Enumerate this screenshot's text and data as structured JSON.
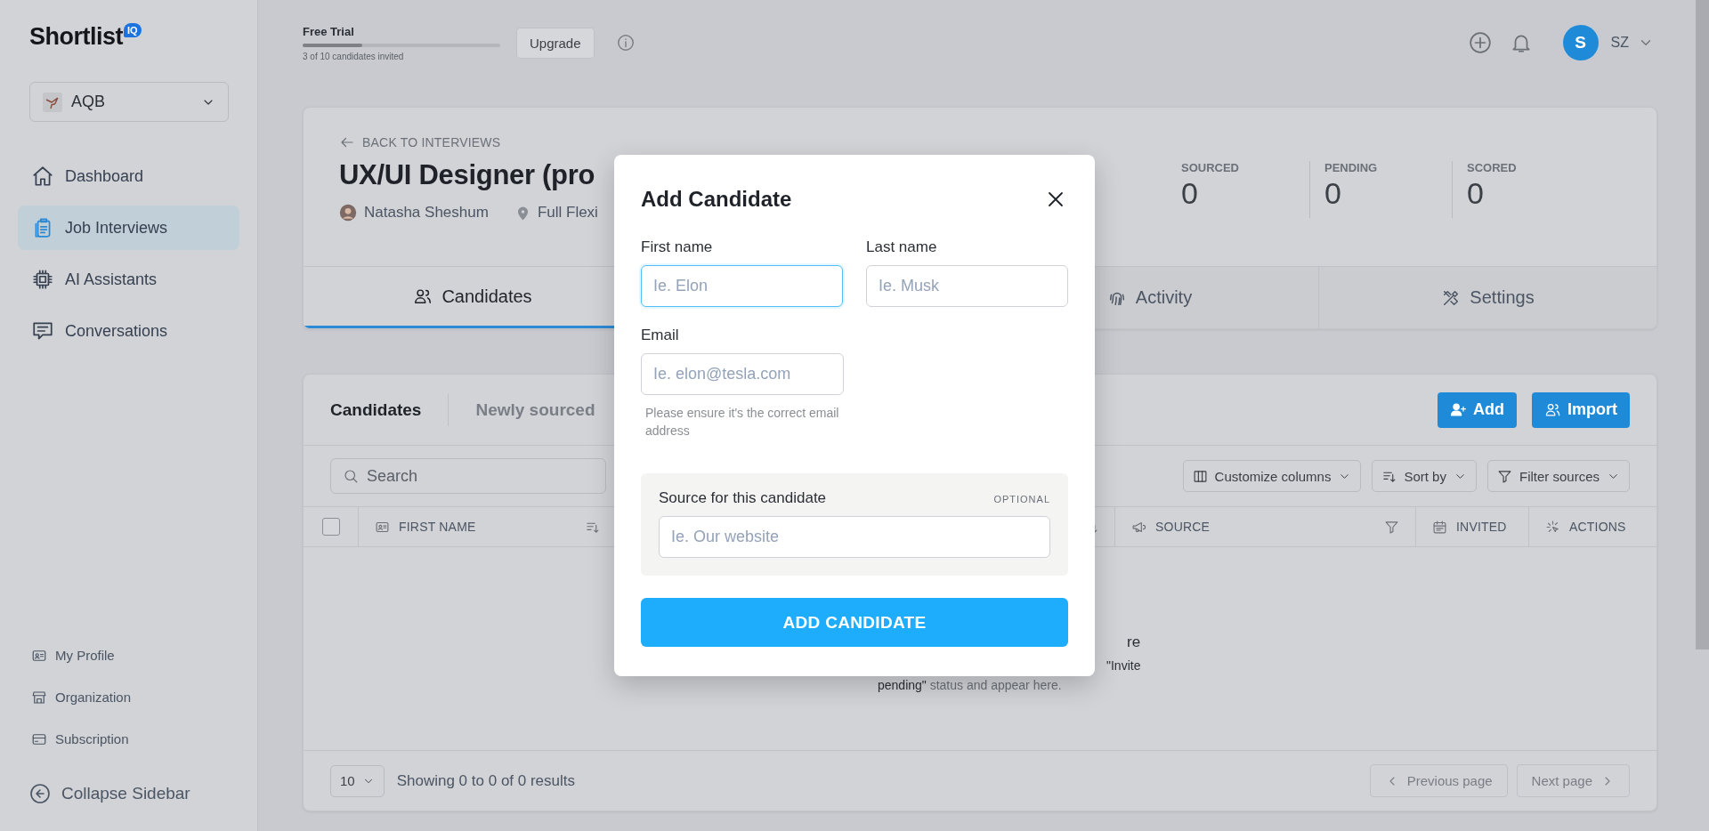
{
  "sidebar": {
    "logo": "Shortlist",
    "logo_badge": "IQ",
    "org": "AQB",
    "items": [
      {
        "label": "Dashboard",
        "selected": false
      },
      {
        "label": "Job Interviews",
        "selected": true
      },
      {
        "label": "AI Assistants",
        "selected": false
      },
      {
        "label": "Conversations",
        "selected": false
      }
    ],
    "bottom_items": [
      {
        "label": "My Profile"
      },
      {
        "label": "Organization"
      },
      {
        "label": "Subscription"
      }
    ],
    "collapse": "Collapse Sidebar"
  },
  "topbar": {
    "plan": "Free Trial",
    "level": 0.3,
    "usage": "3 of 10 candidates invited",
    "upgrade": "Upgrade",
    "avatar": "S",
    "user": "SZ"
  },
  "job": {
    "back": "BACK TO INTERVIEWS",
    "title": "UX/UI Designer (pro",
    "owner": "Natasha Sheshum",
    "location": "Full Flexi",
    "stats": [
      {
        "label": "SOURCED",
        "value": "0"
      },
      {
        "label": "PENDING",
        "value": "0"
      },
      {
        "label": "SCORED",
        "value": "0"
      }
    ],
    "tabs": [
      {
        "label": "Candidates",
        "selected": true
      },
      {
        "label": "Activity",
        "selected": false
      },
      {
        "label": "Settings",
        "selected": false
      }
    ]
  },
  "candidates": {
    "tabs": [
      {
        "label": "Candidates",
        "selected": true
      },
      {
        "label": "Newly sourced",
        "selected": false
      }
    ],
    "add": "Add",
    "import": "Import",
    "search_placeholder": "Search",
    "tools": [
      {
        "label": "Customize columns"
      },
      {
        "label": "Sort by"
      },
      {
        "label": "Filter sources"
      }
    ],
    "select_all_checked": false,
    "columns": [
      {
        "label": "FIRST NAME"
      },
      {
        "kind": "hidden"
      },
      {
        "label": "SOURCE"
      },
      {
        "label": "INVITED"
      },
      {
        "label": "ACTIONS"
      }
    ],
    "empty_title": "re",
    "empty_line_1": "\"Invite",
    "empty_line_2": "**pending\"** status and appear here.",
    "page_size": "10",
    "summary": "Showing 0 to 0 of 0 results",
    "prev": "Previous page",
    "next": "Next page"
  },
  "modal": {
    "title": "Add Candidate",
    "first_name": {
      "label": "First name",
      "placeholder": "Ie. Elon",
      "focused": true
    },
    "last_name": {
      "label": "Last name",
      "placeholder": "Ie. Musk",
      "focused": false
    },
    "email": {
      "label": "Email",
      "placeholder": "Ie. elon@tesla.com",
      "hint": "Please ensure it's the correct email address"
    },
    "source": {
      "label": "Source for this candidate",
      "tag": "OPTIONAL",
      "placeholder": "Ie. Our website"
    },
    "submit": "ADD CANDIDATE"
  }
}
